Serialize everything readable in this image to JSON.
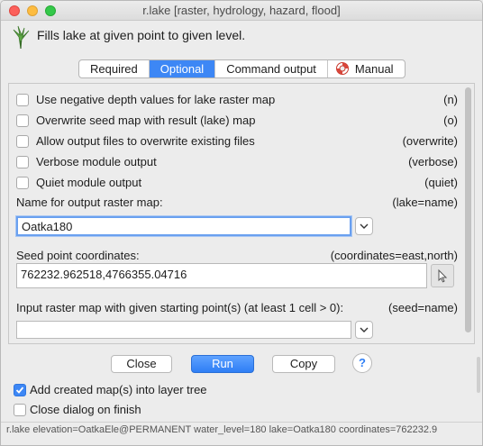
{
  "window": {
    "title": "r.lake [raster, hydrology, hazard, flood]"
  },
  "header": {
    "description": "Fills lake at given point to given level."
  },
  "tabs": [
    {
      "label": "Required",
      "active": false
    },
    {
      "label": "Optional",
      "active": true
    },
    {
      "label": "Command output",
      "active": false
    },
    {
      "label": "Manual",
      "active": false,
      "icon": "lifebuoy-icon"
    }
  ],
  "options": [
    {
      "label": "Use negative depth values for lake raster map",
      "key": "(n)",
      "checked": false
    },
    {
      "label": "Overwrite seed map with result (lake) map",
      "key": "(o)",
      "checked": false
    },
    {
      "label": "Allow output files to overwrite existing files",
      "key": "(overwrite)",
      "checked": false
    },
    {
      "label": "Verbose module output",
      "key": "(verbose)",
      "checked": false
    },
    {
      "label": "Quiet module output",
      "key": "(quiet)",
      "checked": false
    }
  ],
  "fields": {
    "lake": {
      "label": "Name for output raster map:",
      "key": "(lake=name)",
      "value": "Oatka180"
    },
    "coordinates": {
      "label": "Seed point coordinates:",
      "key": "(coordinates=east,north)",
      "value": "762232.962518,4766355.04716"
    },
    "seed": {
      "label": "Input raster map with given starting point(s) (at least 1 cell > 0):",
      "key": "(seed=name)",
      "value": ""
    }
  },
  "buttons": {
    "close": "Close",
    "run": "Run",
    "copy": "Copy",
    "help": "?"
  },
  "bottom": {
    "add_layer": {
      "label": "Add created map(s) into layer tree",
      "checked": true
    },
    "close_finish": {
      "label": "Close dialog on finish",
      "checked": false
    }
  },
  "status": {
    "command": "r.lake elevation=OatkaEle@PERMANENT water_level=180 lake=Oatka180 coordinates=762232.9"
  },
  "colors": {
    "accent": "#3d87f5",
    "focus": "#6aa0ef"
  }
}
